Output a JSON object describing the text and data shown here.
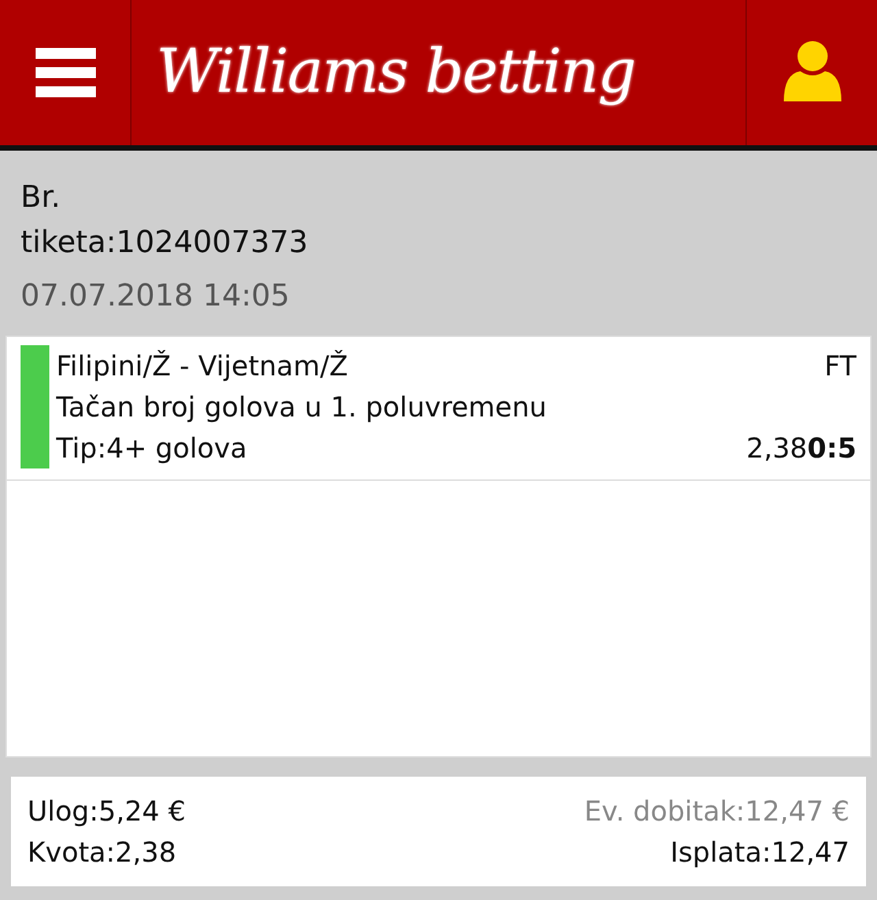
{
  "header": {
    "logo": "Williams betting"
  },
  "ticket": {
    "label_line1": "Br.",
    "label_line2": "tiketa:1024007373",
    "datetime": "07.07.2018 14:05"
  },
  "bets": [
    {
      "match": "Filipini/Ž - Vijetnam/Ž",
      "status": "FT",
      "market": "Tačan broj golova u 1. poluvremenu",
      "tip": "Tip:4+ golova",
      "odds": "2,38",
      "score": "0:5",
      "color": "#4ccc4c"
    }
  ],
  "summary": {
    "stake": "Ulog:5,24 €",
    "potential_win": "Ev. dobitak:12,47 €",
    "odds": "Kvota:2,38",
    "payout": "Isplata:12,47"
  }
}
